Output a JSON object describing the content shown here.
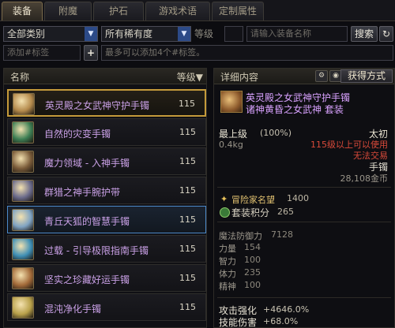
{
  "tabs": [
    "装备",
    "附魔",
    "护石",
    "游戏术语",
    "定制属性"
  ],
  "filters": {
    "category": "全部类别",
    "rarity": "所有稀有度",
    "level_label": "等级",
    "search_placeholder": "请输入装备名称",
    "search_button": "搜索",
    "refresh_icon": "refresh-icon",
    "tag_placeholder": "添加#标签",
    "tag_hint": "最多可以添加4个#标签。",
    "add_button": "+"
  },
  "list": {
    "header_name": "名称",
    "header_level": "等级▼",
    "items": [
      {
        "name": "英灵殿之女武神守护手镯",
        "level": "115",
        "state": "gold",
        "icon_color": "#b48a4c"
      },
      {
        "name": "自然的灾变手镯",
        "level": "115",
        "state": "",
        "icon_color": "#3e7f54"
      },
      {
        "name": "魔力领域 - 入神手镯",
        "level": "115",
        "state": "",
        "icon_color": "#7b5c3a"
      },
      {
        "name": "群猎之神手腕护带",
        "level": "115",
        "state": "",
        "icon_color": "#6a6a8a"
      },
      {
        "name": "青丘天狐的智慧手镯",
        "level": "115",
        "state": "blue",
        "icon_color": "#7fa3c2"
      },
      {
        "name": "过载 - 引导极限指南手镯",
        "level": "115",
        "state": "",
        "icon_color": "#3f8fb5"
      },
      {
        "name": "坚实之珍藏好运手镯",
        "level": "115",
        "state": "",
        "icon_color": "#a36b3a"
      },
      {
        "name": "混沌净化手镯",
        "level": "115",
        "state": "",
        "icon_color": "#b8a04a"
      }
    ]
  },
  "detail": {
    "header": "详细内容",
    "acquire_button": "获得方式",
    "title_line1": "英灵殿之女武神守护手镯",
    "title_line2": "诸神黄昏之女武神  套装",
    "max_level": "最上级",
    "max_pct": "(100%)",
    "weight": "0.4kg",
    "rarity": "太初",
    "restrict1": "115级以上可以使用",
    "restrict2": "无法交易",
    "slot": "手镯",
    "price": "28,108金币",
    "fame_label": "冒险家名望",
    "fame_value": "1400",
    "set_label": "套装积分",
    "set_value": "265",
    "stats": [
      {
        "name": "魔法防御力",
        "value": "7128"
      },
      {
        "name": "力量",
        "value": "154"
      },
      {
        "name": "智力",
        "value": "100"
      },
      {
        "name": "体力",
        "value": "235"
      },
      {
        "name": "精神",
        "value": "100"
      }
    ],
    "attack_label": "攻击强化",
    "attack_value": "+4646.0%",
    "skill_label": "技能伤害",
    "skill_value": "+68.0%"
  }
}
